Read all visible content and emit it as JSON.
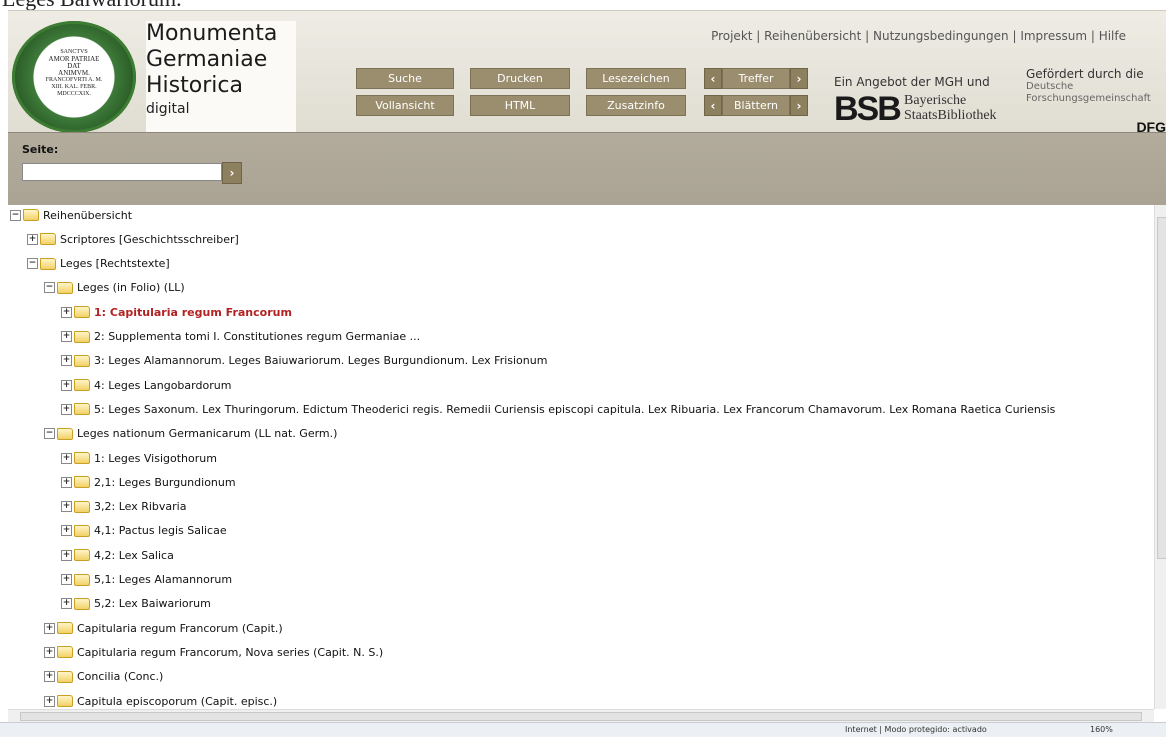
{
  "caption": "Leges Baiwariorum.",
  "logo": {
    "seal_lines": [
      "SANCTVS",
      "AMOR PATRIAE",
      "DAT",
      "ANIMVM.",
      "FRANCOFVRTI A. M.",
      "XIII. KAL. FEBR.",
      "MDCCCXIX."
    ],
    "title_lines": [
      "Monumenta",
      "Germaniae",
      "Historica"
    ],
    "subtitle": "digital"
  },
  "top_links": [
    "Projekt",
    "Reihenübersicht",
    "Nutzungsbedingungen",
    "Impressum",
    "Hilfe"
  ],
  "toolbar": {
    "suche": "Suche",
    "drucken": "Drucken",
    "lesezeichen": "Lesezeichen",
    "treffer": "Treffer",
    "vollansicht": "Vollansicht",
    "html": "HTML",
    "zusatzinfo": "Zusatzinfo",
    "blaettern": "Blättern",
    "prev_symbol": "‹",
    "next_symbol": "›"
  },
  "sponsor": {
    "mgh_text": "Ein Angebot der MGH und",
    "bsb_letters": "BSB",
    "bsb_name_1": "Bayerische",
    "bsb_name_2": "StaatsBibliothek",
    "dfg_title": "Gefördert durch die",
    "dfg_name_1": "Deutsche",
    "dfg_name_2": "Forschungsgemeinschaft",
    "dfg_logo": "DFG"
  },
  "page_jump": {
    "label": "Seite:",
    "value": "",
    "go": "›"
  },
  "tree": [
    {
      "label": "Reihenübersicht",
      "state": "open",
      "depth": 0
    },
    {
      "label": "Scriptores [Geschichtsschreiber]",
      "state": "closed",
      "depth": 1
    },
    {
      "label": "Leges [Rechtstexte]",
      "state": "open",
      "depth": 1
    },
    {
      "label": "Leges (in Folio) (LL)",
      "state": "open",
      "depth": 2
    },
    {
      "label": "1: Capitularia regum Francorum",
      "state": "closed",
      "depth": 3,
      "active": true
    },
    {
      "label": "2: Supplementa tomi I. Constitutiones regum Germaniae ...",
      "state": "closed",
      "depth": 3
    },
    {
      "label": "3: Leges Alamannorum. Leges Baiuwariorum. Leges Burgundionum. Lex Frisionum",
      "state": "closed",
      "depth": 3
    },
    {
      "label": "4: Leges Langobardorum",
      "state": "closed",
      "depth": 3
    },
    {
      "label": "5: Leges Saxonum. Lex Thuringorum. Edictum Theoderici regis. Remedii Curiensis episcopi capitula. Lex Ribuaria. Lex Francorum Chamavorum. Lex Romana Raetica Curiensis",
      "state": "closed",
      "depth": 3
    },
    {
      "label": "Leges nationum Germanicarum (LL nat. Germ.)",
      "state": "open",
      "depth": 2
    },
    {
      "label": "1: Leges Visigothorum",
      "state": "closed",
      "depth": 3
    },
    {
      "label": "2,1: Leges Burgundionum",
      "state": "closed",
      "depth": 3
    },
    {
      "label": "3,2: Lex Ribvaria",
      "state": "closed",
      "depth": 3
    },
    {
      "label": "4,1: Pactus legis Salicae",
      "state": "closed",
      "depth": 3
    },
    {
      "label": "4,2: Lex Salica",
      "state": "closed",
      "depth": 3
    },
    {
      "label": "5,1: Leges Alamannorum",
      "state": "closed",
      "depth": 3
    },
    {
      "label": "5,2: Lex Baiwariorum",
      "state": "closed",
      "depth": 3
    },
    {
      "label": "Capitularia regum Francorum (Capit.)",
      "state": "closed",
      "depth": 2
    },
    {
      "label": "Capitularia regum Francorum, Nova series (Capit. N. S.)",
      "state": "closed",
      "depth": 2
    },
    {
      "label": "Concilia (Conc.)",
      "state": "closed",
      "depth": 2
    },
    {
      "label": "Capitula episcoporum (Capit. episc.)",
      "state": "closed",
      "depth": 2
    }
  ],
  "statusbar": {
    "status": "Internet | Modo protegido: activado",
    "zoom": "160%"
  }
}
